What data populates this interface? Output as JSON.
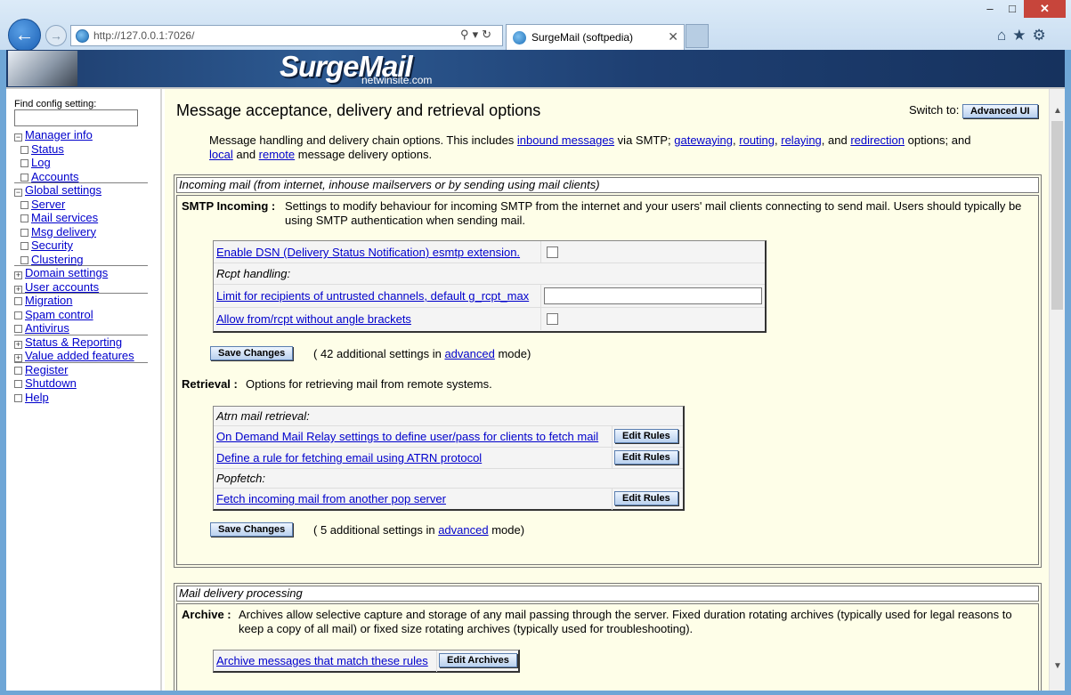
{
  "browser": {
    "url": "http://127.0.0.1:7026/",
    "tab_title": "SurgeMail (softpedia)",
    "window_controls": {
      "minimize": "–",
      "maximize": "□",
      "close": "✕"
    },
    "icons": [
      "back-arrow-icon",
      "forward-arrow-icon",
      "ie-globe-icon",
      "search-icon",
      "refresh-icon",
      "home-icon",
      "favorites-star-icon",
      "gear-icon"
    ]
  },
  "banner": {
    "logo": "SurgeMail",
    "subtitle": "netwinsite.com"
  },
  "sidebar": {
    "find_label": "Find config setting:",
    "find_value": "",
    "items": [
      {
        "label": "Manager info",
        "marker": "−",
        "sub": false,
        "sep": false
      },
      {
        "label": "Status",
        "marker": "",
        "sub": true,
        "sep": false
      },
      {
        "label": "Log",
        "marker": "",
        "sub": true,
        "sep": false
      },
      {
        "label": "Accounts",
        "marker": "",
        "sub": true,
        "sep": true
      },
      {
        "label": "Global settings",
        "marker": "−",
        "sub": false,
        "sep": false
      },
      {
        "label": "Server",
        "marker": "",
        "sub": true,
        "sep": false
      },
      {
        "label": "Mail services",
        "marker": "",
        "sub": true,
        "sep": false
      },
      {
        "label": "Msg delivery",
        "marker": "",
        "sub": true,
        "sep": false
      },
      {
        "label": "Security",
        "marker": "",
        "sub": true,
        "sep": false
      },
      {
        "label": "Clustering",
        "marker": "",
        "sub": true,
        "sep": true
      },
      {
        "label": "Domain settings",
        "marker": "+",
        "sub": false,
        "sep": false
      },
      {
        "label": "User accounts",
        "marker": "+",
        "sub": false,
        "sep": true
      },
      {
        "label": "Migration",
        "marker": "",
        "sub": false,
        "sep": false
      },
      {
        "label": "Spam control",
        "marker": "",
        "sub": false,
        "sep": false
      },
      {
        "label": "Antivirus",
        "marker": "",
        "sub": false,
        "sep": true
      },
      {
        "label": "Status & Reporting",
        "marker": "+",
        "sub": false,
        "sep": false
      },
      {
        "label": "Value added features",
        "marker": "+",
        "sub": false,
        "sep": true
      },
      {
        "label": "Register",
        "marker": "",
        "sub": false,
        "sep": false
      },
      {
        "label": "Shutdown",
        "marker": "",
        "sub": false,
        "sep": false
      },
      {
        "label": "Help",
        "marker": "",
        "sub": false,
        "sep": false
      }
    ]
  },
  "main": {
    "title": "Message acceptance, delivery and retrieval options",
    "switch_label": "Switch to:",
    "advanced_ui_button": "Advanced UI",
    "intro": {
      "t1": "Message handling and delivery chain options. This includes ",
      "l1": "inbound messages",
      "t2": " via SMTP; ",
      "l2": "gatewaying",
      "t3": ", ",
      "l3": "routing",
      "t4": ", ",
      "l4": "relaying",
      "t5": ", and ",
      "l5": "redirection",
      "t6": " options; and",
      "l6": "local",
      "t7": " and ",
      "l7": "remote",
      "t8": " message delivery options."
    },
    "incoming": {
      "header": "Incoming mail (from internet, inhouse mailservers or by sending using mail clients)",
      "smtp_label": "SMTP Incoming :",
      "smtp_desc": "Settings to modify behaviour for incoming SMTP from the internet and your users' mail clients connecting to send mail. Users should typically be using SMTP authentication when sending mail.",
      "opt_dsn": "Enable DSN (Delivery Status Notification) esmtp extension.",
      "opt_rcpt_heading": "Rcpt handling:",
      "opt_limit": "Limit for recipients of untrusted channels, default g_rcpt_max",
      "opt_limit_value": "",
      "opt_angle": "Allow from/rcpt without angle brackets",
      "save_button": "Save Changes",
      "extra_pre": "( 42 additional settings in ",
      "extra_link": "advanced",
      "extra_post": " mode)",
      "retrieval_label": "Retrieval :",
      "retrieval_desc": "Options for retrieving mail from remote systems.",
      "atrn_heading": "Atrn mail retrieval:",
      "odmr_link": "On Demand Mail Relay settings to define user/pass for clients to fetch mail",
      "atrn_link": "Define a rule for fetching email using ATRN protocol",
      "popfetch_heading": "Popfetch:",
      "fetch_link": "Fetch incoming mail from another pop server",
      "edit_rules": "Edit Rules",
      "save_button2": "Save Changes",
      "extra2_pre": "( 5 additional settings in ",
      "extra2_link": "advanced",
      "extra2_post": " mode)"
    },
    "delivery": {
      "header": "Mail delivery processing",
      "archive_label": "Archive :",
      "archive_desc": "Archives allow selective capture and storage of any mail passing through the server. Fixed duration rotating archives (typically used for legal reasons to keep a copy of all mail) or fixed size rotating archives (typically used for troubleshooting).",
      "archive_link": "Archive messages that match these rules",
      "edit_archives": "Edit Archives"
    }
  }
}
